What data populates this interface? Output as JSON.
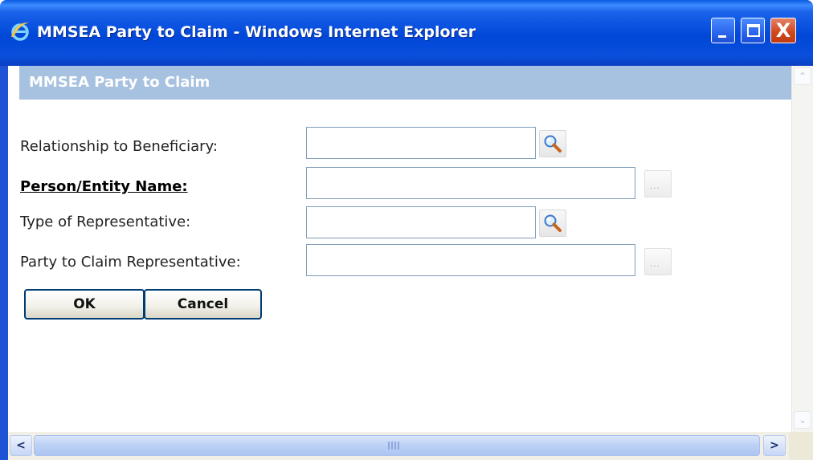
{
  "window": {
    "title": "MMSEA Party to Claim - Windows Internet Explorer",
    "icon": "ie-logo-icon",
    "controls": {
      "minimize": "minimize-icon",
      "maximize": "maximize-icon",
      "close": "close-icon",
      "close_glyph": "X"
    }
  },
  "panel": {
    "title": "MMSEA Party to Claim"
  },
  "form": {
    "fields": [
      {
        "label": "Relationship to Beneficiary:",
        "value": "",
        "required": false,
        "action_icon": "magnifier-icon"
      },
      {
        "label": "Person/Entity Name:",
        "value": "",
        "required": true,
        "action_icon": "ellipsis-icon"
      },
      {
        "label": "Type of Representative:",
        "value": "",
        "required": false,
        "action_icon": "magnifier-icon"
      },
      {
        "label": "Party to Claim Representative:",
        "value": "",
        "required": false,
        "action_icon": "ellipsis-icon"
      }
    ],
    "ellipsis_glyph": "...",
    "ok_label": "OK",
    "cancel_label": "Cancel"
  },
  "scrollbars": {
    "up_glyph": "⌃",
    "down_glyph": "⌄",
    "left_glyph": "<",
    "right_glyph": ">"
  },
  "colors": {
    "titlebar": "#0047d8",
    "panel_header": "#a7c1e0",
    "input_border": "#7f9db9",
    "button_border": "#003c74"
  }
}
